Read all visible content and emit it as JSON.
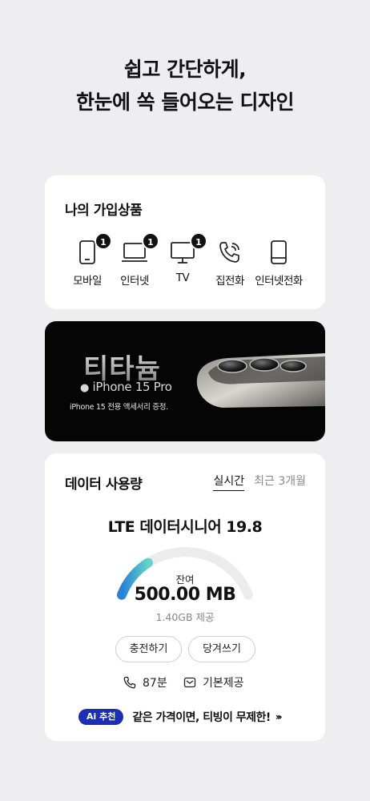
{
  "headline": {
    "line1": "쉽고 간단하게,",
    "line2": "한눈에 쏙 들어오는 디자인"
  },
  "products": {
    "title": "나의 가입상품",
    "items": [
      {
        "label": "모바일",
        "icon": "mobile-phone-icon",
        "badge": "1"
      },
      {
        "label": "인터넷",
        "icon": "laptop-icon",
        "badge": "1"
      },
      {
        "label": "TV",
        "icon": "tv-icon",
        "badge": "1"
      },
      {
        "label": "집전화",
        "icon": "phone-call-icon",
        "badge": ""
      },
      {
        "label": "인터넷전화",
        "icon": "desk-phone-icon",
        "badge": ""
      }
    ]
  },
  "banner": {
    "logo": "티타늄",
    "model": "iPhone 15 Pro",
    "subtitle": "iPhone 15 전용 액세서리 증정."
  },
  "data_usage": {
    "title": "데이터 사용량",
    "tabs": [
      "실시간",
      "최근 3개월"
    ],
    "active_tab": "실시간",
    "plan_name": "LTE 데이터시니어 19.8",
    "remaining_label": "잔여",
    "remaining_value": "500.00 MB",
    "provided": "1.40GB 제공",
    "remaining_fraction": 0.26,
    "buttons": {
      "charge": "충전하기",
      "pull": "당겨쓰기"
    },
    "voice": "87분",
    "sms": "기본제공"
  },
  "ai": {
    "badge": "Ai 추천",
    "text": "같은 가격이면, 티빙이 무제한!",
    "arrow": "›››"
  },
  "colors": {
    "accent_blue": "#1c2fb3",
    "gauge_start": "#2a7fd6",
    "gauge_end": "#63d4c8",
    "gauge_track": "#ececec"
  }
}
